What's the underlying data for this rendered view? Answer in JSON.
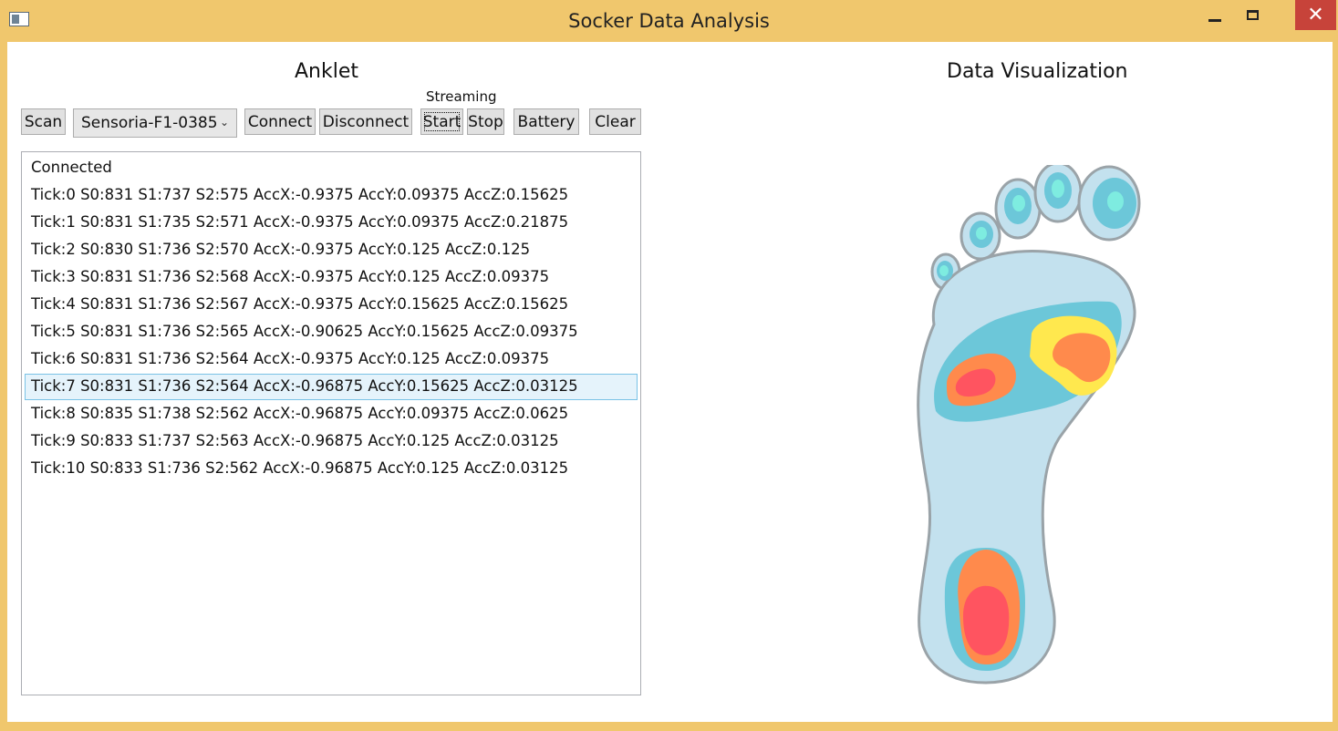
{
  "window": {
    "title": "Socker Data Analysis",
    "close_glyph": "✕"
  },
  "anklet": {
    "title": "Anklet",
    "streaming_label": "Streaming",
    "buttons": {
      "scan": "Scan",
      "connect": "Connect",
      "disconnect": "Disconnect",
      "start": "Start",
      "stop": "Stop",
      "battery": "Battery",
      "clear": "Clear"
    },
    "device_select": {
      "value": "Sensoria-F1-0385",
      "arrow": "⌄"
    },
    "log": [
      "Connected",
      "Tick:0 S0:831 S1:737 S2:575 AccX:-0.9375 AccY:0.09375 AccZ:0.15625",
      "Tick:1 S0:831 S1:735 S2:571 AccX:-0.9375 AccY:0.09375 AccZ:0.21875",
      "Tick:2 S0:830 S1:736 S2:570 AccX:-0.9375 AccY:0.125 AccZ:0.125",
      "Tick:3 S0:831 S1:736 S2:568 AccX:-0.9375 AccY:0.125 AccZ:0.09375",
      "Tick:4 S0:831 S1:736 S2:567 AccX:-0.9375 AccY:0.15625 AccZ:0.15625",
      "Tick:5 S0:831 S1:736 S2:565 AccX:-0.90625 AccY:0.15625 AccZ:0.09375",
      "Tick:6 S0:831 S1:736 S2:564 AccX:-0.9375 AccY:0.125 AccZ:0.09375",
      "Tick:7 S0:831 S1:736 S2:564 AccX:-0.96875 AccY:0.15625 AccZ:0.03125",
      "Tick:8 S0:835 S1:738 S2:562 AccX:-0.96875 AccY:0.09375 AccZ:0.0625",
      "Tick:9 S0:833 S1:737 S2:563 AccX:-0.96875 AccY:0.125 AccZ:0.03125",
      "Tick:10 S0:833 S1:736 S2:562 AccX:-0.96875 AccY:0.125 AccZ:0.03125"
    ],
    "selected_index": 8
  },
  "visualization": {
    "title": "Data Visualization",
    "colors": {
      "foot_base": "#c3e1ee",
      "foot_outline": "#9aa3a8",
      "zone_cyan": "#6cc7d9",
      "toe_highlight": "#7eece0",
      "hot_orange": "#ff8a4c",
      "hot_red": "#ff5460",
      "hot_yellow": "#ffe84e"
    }
  }
}
